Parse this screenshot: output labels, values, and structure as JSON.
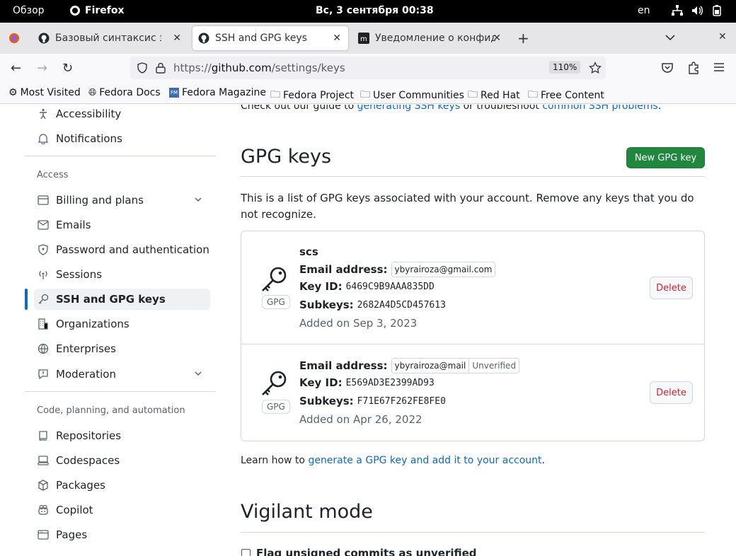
{
  "system_bar": {
    "overview": "Обзор",
    "app_name": "Firefox",
    "datetime": "Вс, 3 сентября  00:38",
    "lang": "en"
  },
  "tabs": [
    {
      "label": "Базовый синтаксис запи"
    },
    {
      "label": "SSH and GPG keys"
    },
    {
      "label": "Уведомление о конфиде"
    }
  ],
  "navbar": {
    "url_prefix": "https://",
    "url_host": "github.com",
    "url_path": "/settings/keys",
    "zoom": "110%"
  },
  "bookmarks": [
    {
      "label": "Most Visited"
    },
    {
      "label": "Fedora Docs"
    },
    {
      "label": "Fedora Magazine"
    },
    {
      "label": "Fedora Project"
    },
    {
      "label": "User Communities"
    },
    {
      "label": "Red Hat"
    },
    {
      "label": "Free Content"
    }
  ],
  "sidebar": {
    "accessibility": "Accessibility",
    "notifications": "Notifications",
    "access_heading": "Access",
    "billing": "Billing and plans",
    "emails": "Emails",
    "password": "Password and authentication",
    "sessions": "Sessions",
    "ssh_gpg": "SSH and GPG keys",
    "organizations": "Organizations",
    "enterprises": "Enterprises",
    "moderation": "Moderation",
    "code_heading": "Code, planning, and automation",
    "repositories": "Repositories",
    "codespaces": "Codespaces",
    "packages": "Packages",
    "copilot": "Copilot",
    "pages": "Pages"
  },
  "main": {
    "ssh_help_prefix": "Check out our guide to ",
    "ssh_help_link1": "generating SSH keys",
    "ssh_help_mid": " or troubleshoot ",
    "ssh_help_link2": "common SSH problems",
    "ssh_help_suffix": ".",
    "gpg_title": "GPG keys",
    "new_gpg_button": "New GPG key",
    "gpg_desc": "This is a list of GPG keys associated with your account. Remove any keys that you do not recognize.",
    "keys": [
      {
        "name": "scs",
        "email_label": "Email address:",
        "email": "ybyrairoza@gmail.com",
        "keyid_label": "Key ID:",
        "keyid": "6469C9B9AAA835DD",
        "subkeys_label": "Subkeys:",
        "subkeys": "2682A4D5CD457613",
        "added": "Added on Sep 3, 2023",
        "badge": "GPG",
        "delete": "Delete"
      },
      {
        "email_label": "Email address:",
        "email": "ybyrairoza@mail",
        "email_status": "Unverified",
        "keyid_label": "Key ID:",
        "keyid": "E569AD3E2399AD93",
        "subkeys_label": "Subkeys:",
        "subkeys": "F71E67F262FE8FE0",
        "added": "Added on Apr 26, 2022",
        "badge": "GPG",
        "delete": "Delete"
      }
    ],
    "learn_prefix": "Learn how to ",
    "learn_link": "generate a GPG key and add it to your account",
    "learn_suffix": ".",
    "vigilant_title": "Vigilant mode",
    "flag_label": "Flag unsigned commits as unverified"
  },
  "colors": {
    "accent": "#0969da",
    "green": "#1f883d",
    "danger": "#cf222e"
  }
}
